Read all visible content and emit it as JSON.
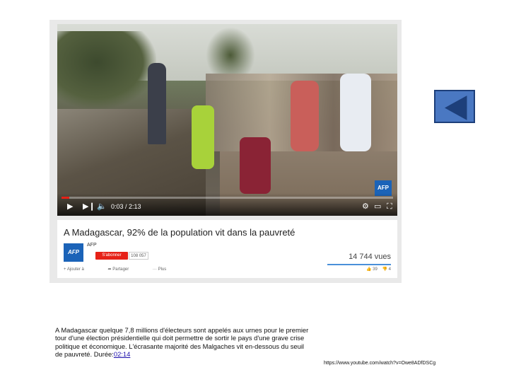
{
  "video": {
    "time_display": "0:03 / 2:13",
    "progress": 0.023,
    "badge": "AFP",
    "controls": {
      "play_icon": "play-icon",
      "next_icon": "next-icon",
      "volume_icon": "volume-icon",
      "settings_icon": "gear-icon",
      "theater_icon": "theater-icon",
      "fullscreen_icon": "fullscreen-icon"
    }
  },
  "info": {
    "title": "A Madagascar, 92% de la population vit dans la pauvreté",
    "channel_logo": "AFP",
    "channel_name": "AFP",
    "subscribe_label": "S'abonner",
    "subscriber_count": "108 057",
    "views": "14 744 vues",
    "actions": [
      "Ajouter à",
      "Partager",
      "Plus"
    ],
    "likes": "39",
    "dislikes": "4"
  },
  "description": {
    "text": "A Madagascar quelque 7,8 millions d'électeurs sont appelés aux urnes pour le premier tour d'une élection présidentielle qui doit permettre de sortir le pays d'une grave crise politique et économique. L'écrasante majorité des Malgaches vit en-dessous du seuil de pauvreté. Durée:",
    "duration_link": "02:14"
  },
  "source_url": "https://www.youtube.com/watch?v=Owe8ADfDSCg",
  "colors": {
    "accent_red": "#e62117",
    "afp_blue": "#1b63b8",
    "nav_button": "#4a78c2"
  }
}
